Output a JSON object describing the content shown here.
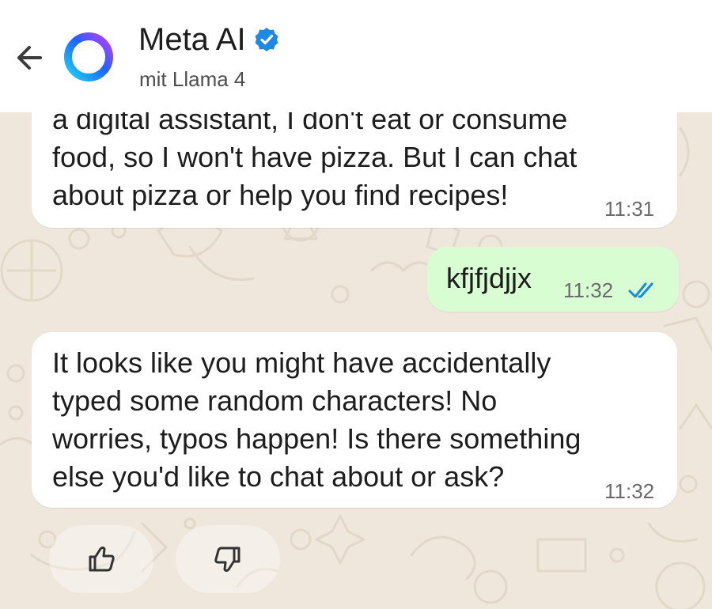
{
  "header": {
    "title": "Meta AI",
    "subtitle": "mit Llama 4",
    "back_icon": "arrow-left-icon",
    "avatar_icon": "meta-ai-ring-icon",
    "verified_icon": "verified-badge-icon",
    "colors": {
      "verified": "#1e88e5",
      "ring_start": "#1fd1f9",
      "ring_mid": "#1e63ff",
      "ring_end": "#c23bff"
    }
  },
  "messages": [
    {
      "direction": "incoming",
      "text": "a digital assistant, I don't eat or consume\nfood, so I won't have pizza. But I can chat\nabout pizza or help you find recipes!",
      "time": "11:31"
    },
    {
      "direction": "outgoing",
      "text": "kfjfjdjjx",
      "time": "11:32",
      "status": "read",
      "status_icon": "double-check-icon",
      "status_color": "#1a8cd8"
    },
    {
      "direction": "incoming",
      "text": "It looks like you might have accidentally\ntyped some random characters! No\nworries, typos happen! Is there something\nelse you'd like to chat about or ask?",
      "time": "11:32"
    }
  ],
  "reactions": {
    "like_icon": "thumbs-up-icon",
    "dislike_icon": "thumbs-down-icon"
  },
  "colors": {
    "chat_background": "#efe7dc",
    "incoming_bubble": "#ffffff",
    "outgoing_bubble": "#d8fdd2"
  }
}
